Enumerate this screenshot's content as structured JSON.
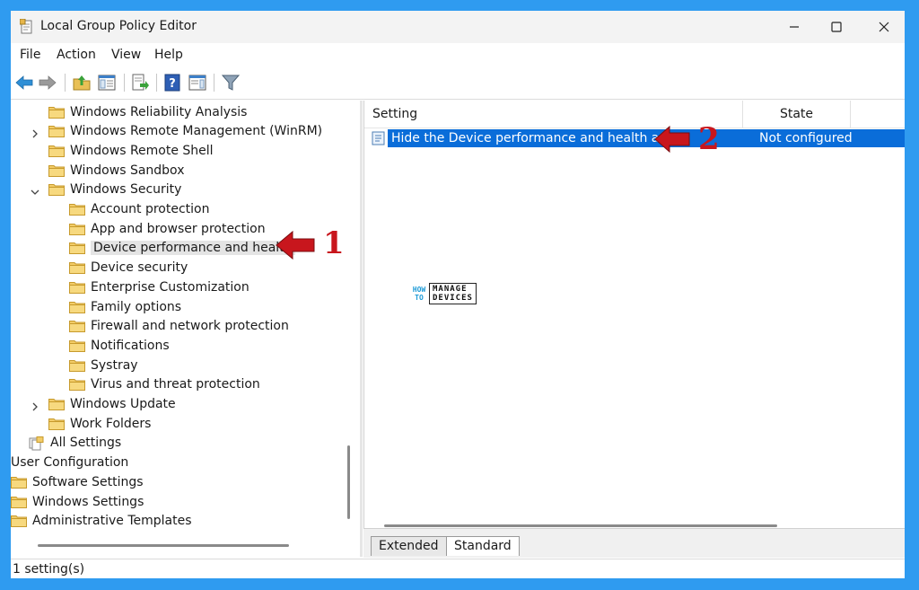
{
  "window": {
    "title": "Local Group Policy Editor"
  },
  "menu": [
    "File",
    "Action",
    "View",
    "Help"
  ],
  "tree": {
    "items": [
      {
        "label": "Windows Reliability Analysis",
        "level": 2,
        "expander": "none"
      },
      {
        "label": "Windows Remote Management (WinRM)",
        "level": 2,
        "expander": "collapsed"
      },
      {
        "label": "Windows Remote Shell",
        "level": 2,
        "expander": "none"
      },
      {
        "label": "Windows Sandbox",
        "level": 2,
        "expander": "none"
      },
      {
        "label": "Windows Security",
        "level": 2,
        "expander": "expanded"
      },
      {
        "label": "Account protection",
        "level": 3,
        "expander": "none"
      },
      {
        "label": "App and browser protection",
        "level": 3,
        "expander": "none"
      },
      {
        "label": "Device performance and health",
        "level": 3,
        "expander": "none",
        "selected": true
      },
      {
        "label": "Device security",
        "level": 3,
        "expander": "none"
      },
      {
        "label": "Enterprise Customization",
        "level": 3,
        "expander": "none"
      },
      {
        "label": "Family options",
        "level": 3,
        "expander": "none"
      },
      {
        "label": "Firewall and network protection",
        "level": 3,
        "expander": "none"
      },
      {
        "label": "Notifications",
        "level": 3,
        "expander": "none"
      },
      {
        "label": "Systray",
        "level": 3,
        "expander": "none"
      },
      {
        "label": "Virus and threat protection",
        "level": 3,
        "expander": "none"
      },
      {
        "label": "Windows Update",
        "level": 2,
        "expander": "collapsed"
      },
      {
        "label": "Work Folders",
        "level": 2,
        "expander": "none"
      },
      {
        "label": "All Settings",
        "level": 1,
        "expander": "none",
        "icon": "all-settings-icon"
      },
      {
        "label": "User Configuration",
        "level": 0,
        "expander": "none",
        "icon": "none"
      },
      {
        "label": "Software Settings",
        "level": 0,
        "expander": "none"
      },
      {
        "label": "Windows Settings",
        "level": 0,
        "expander": "none"
      },
      {
        "label": "Administrative Templates",
        "level": 0,
        "expander": "none"
      }
    ]
  },
  "list": {
    "columns": [
      "Setting",
      "State"
    ],
    "rows": [
      {
        "setting": "Hide the Device performance and health area",
        "state": "Not configured"
      }
    ]
  },
  "tabs": [
    "Extended",
    "Standard"
  ],
  "status": {
    "text": "1 setting(s)"
  },
  "annotations": {
    "step1": "1",
    "step2": "2",
    "arrow_color": "#c8161d"
  },
  "watermark": {
    "how": "HOW",
    "to": "TO",
    "manage": "MANAGE",
    "devices": "DEVICES"
  },
  "colors": {
    "background": "#2f9bf0",
    "selection": "#0a6dd9"
  }
}
